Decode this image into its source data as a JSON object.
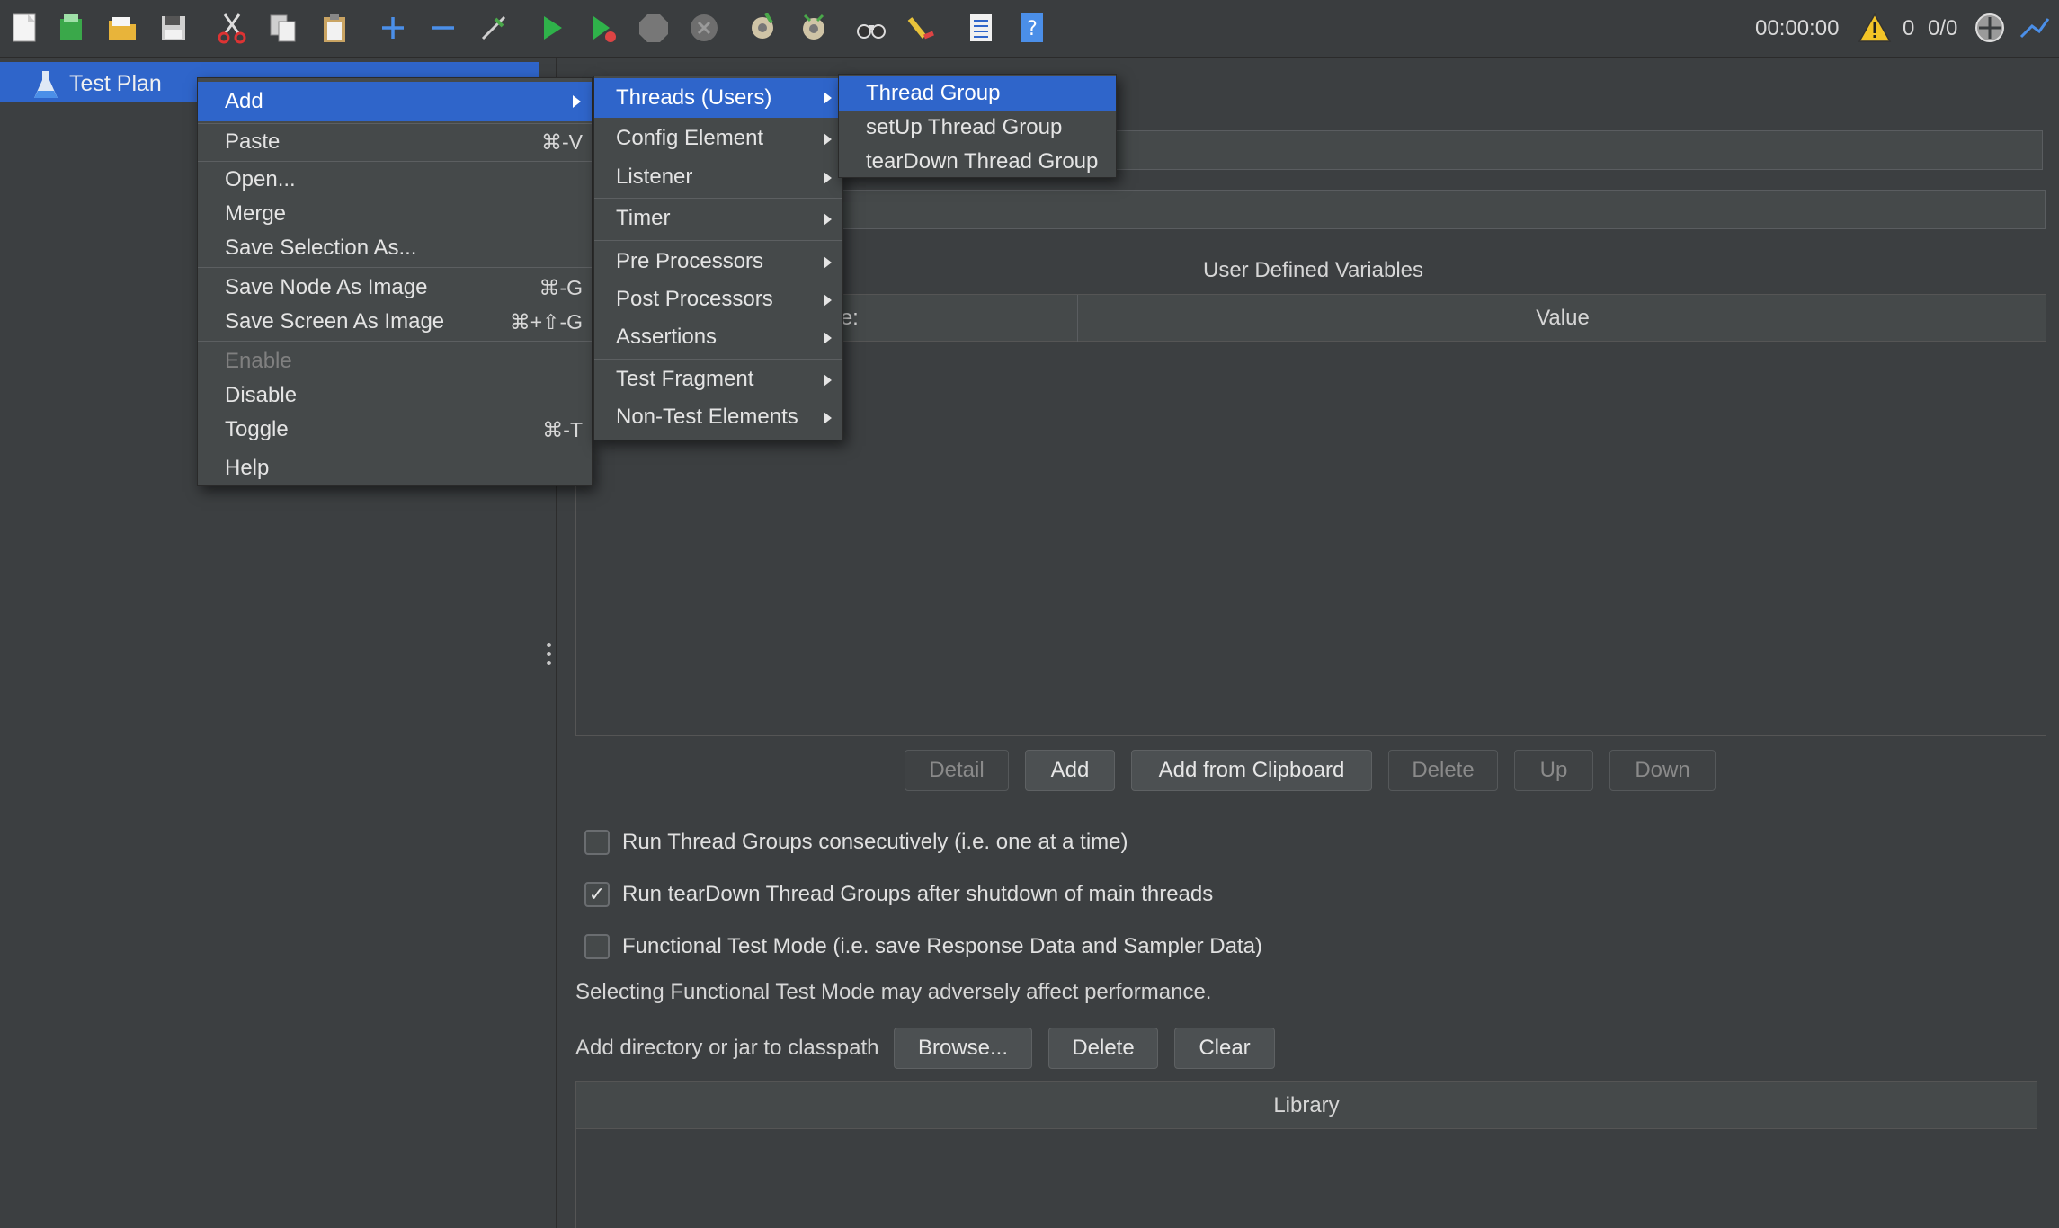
{
  "toolbar": {
    "icons": [
      "new-icon",
      "templates-icon",
      "open-icon",
      "save-icon",
      "cut-icon",
      "copy-icon",
      "paste-icon",
      "expand-icon",
      "collapse-icon",
      "toggle-icon",
      "start-icon",
      "start-no-pauses-icon",
      "stop-icon",
      "shutdown-icon",
      "clear-icon",
      "clear-all-icon",
      "search-icon",
      "reset-search-icon",
      "function-helper-icon",
      "help-icon"
    ],
    "timer": "00:00:00",
    "warning_count": "0",
    "threads": "0/0"
  },
  "tree": {
    "selected_item": "Test Plan"
  },
  "context_menu": {
    "items": [
      {
        "label": "Add",
        "shortcut": ""
      },
      {
        "label": "Paste",
        "shortcut": "⌘-V"
      },
      {
        "label": "Open...",
        "shortcut": ""
      },
      {
        "label": "Merge",
        "shortcut": ""
      },
      {
        "label": "Save Selection As...",
        "shortcut": ""
      },
      {
        "label": "Save Node As Image",
        "shortcut": "⌘-G"
      },
      {
        "label": "Save Screen As Image",
        "shortcut": "⌘+⇧-G"
      },
      {
        "label": "Enable",
        "shortcut": ""
      },
      {
        "label": "Disable",
        "shortcut": ""
      },
      {
        "label": "Toggle",
        "shortcut": "⌘-T"
      },
      {
        "label": "Help",
        "shortcut": ""
      }
    ]
  },
  "add_submenu": {
    "items": [
      "Threads (Users)",
      "Config Element",
      "Listener",
      "Timer",
      "Pre Processors",
      "Post Processors",
      "Assertions",
      "Test Fragment",
      "Non-Test Elements"
    ]
  },
  "threads_submenu": {
    "items": [
      "Thread Group",
      "setUp Thread Group",
      "tearDown Thread Group"
    ]
  },
  "test_plan": {
    "udv_title": "User Defined Variables",
    "columns": [
      "Name:",
      "Value"
    ],
    "buttons": {
      "detail": "Detail",
      "add": "Add",
      "add_clipboard": "Add from Clipboard",
      "delete": "Delete",
      "up": "Up",
      "down": "Down"
    },
    "options": [
      {
        "label": "Run Thread Groups consecutively (i.e. one at a time)",
        "checked": false
      },
      {
        "label": "Run tearDown Thread Groups after shutdown of main threads",
        "checked": true
      },
      {
        "label": "Functional Test Mode (i.e. save Response Data and Sampler Data)",
        "checked": false
      }
    ],
    "functional_note": "Selecting Functional Test Mode may adversely affect performance.",
    "classpath": {
      "label": "Add directory or jar to classpath",
      "browse": "Browse...",
      "delete": "Delete",
      "clear": "Clear",
      "library_header": "Library"
    }
  },
  "colors": {
    "background": "#3c3f41",
    "highlight": "#2f65ca",
    "menu": "#45494a"
  }
}
